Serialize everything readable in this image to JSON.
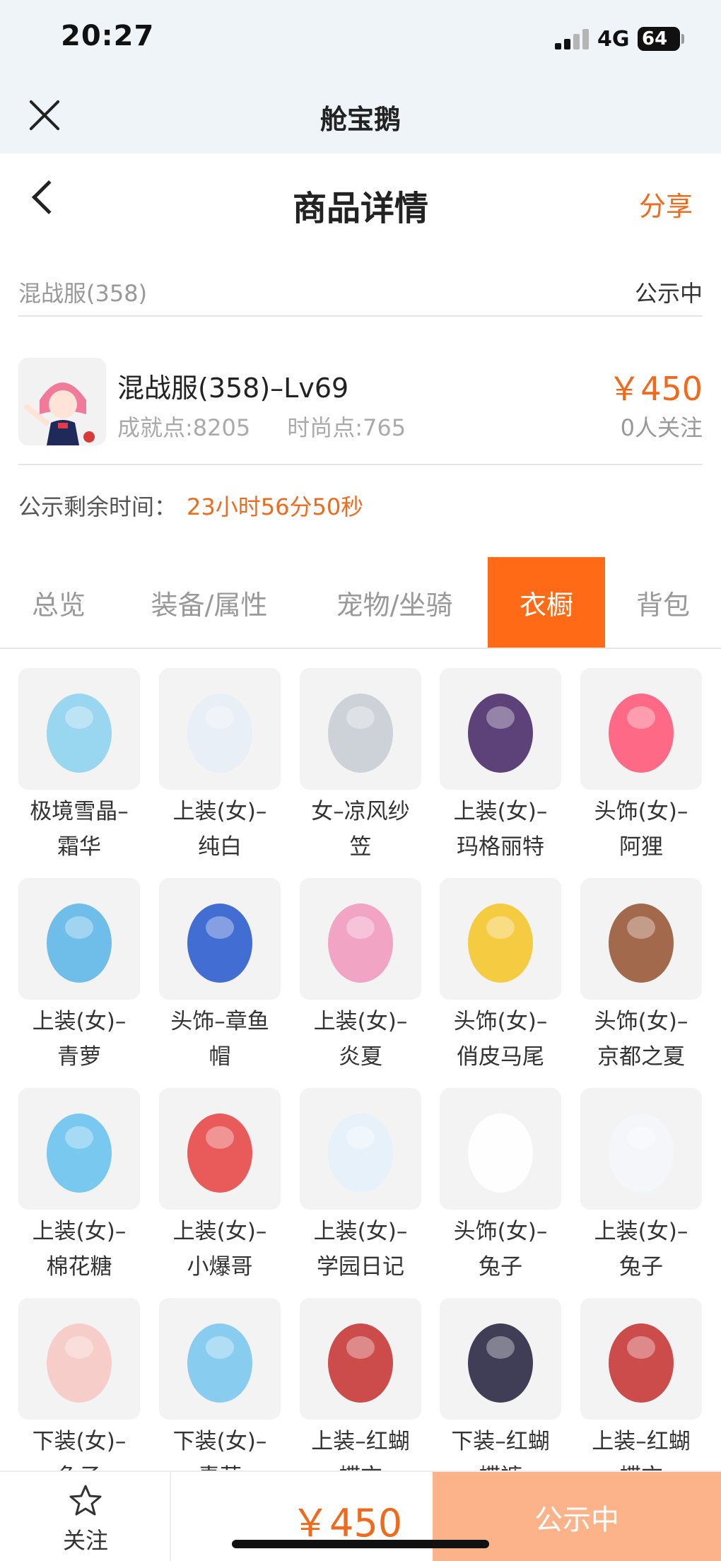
{
  "status_bar": {
    "time": "20:27",
    "network": "4G",
    "battery": "64"
  },
  "mini_header": {
    "title": "舱宝鹅"
  },
  "nav": {
    "title": "商品详情",
    "share": "分享"
  },
  "server": {
    "name": "混战服(358)",
    "status": "公示中"
  },
  "character": {
    "name": "混战服(358)–Lv69",
    "achievement": "成就点:8205",
    "fashion": "时尚点:765",
    "price": "￥450",
    "followers": "0人关注"
  },
  "countdown": {
    "label": "公示剩余时间：",
    "value": "23小时56分50秒"
  },
  "tabs": [
    {
      "label": "总览",
      "active": false
    },
    {
      "label": "装备/属性",
      "active": false
    },
    {
      "label": "宠物/坐骑",
      "active": false
    },
    {
      "label": "衣橱",
      "active": true
    },
    {
      "label": "背包",
      "active": false
    }
  ],
  "wardrobe": [
    {
      "l1": "极境雪晶–",
      "l2": "霜华",
      "icon": "bow-icon",
      "color": "#8fd3ee"
    },
    {
      "l1": "上装(女)–",
      "l2": "纯白",
      "icon": "white-dress-icon",
      "color": "#e8eef6"
    },
    {
      "l1": "女–凉风纱",
      "l2": "笠",
      "icon": "veil-hat-icon",
      "color": "#c9ced6"
    },
    {
      "l1": "上装(女)–",
      "l2": "玛格丽特",
      "icon": "purple-outfit-icon",
      "color": "#4b2f6b"
    },
    {
      "l1": "头饰(女)–",
      "l2": "阿狸",
      "icon": "fox-head-icon",
      "color": "#ff5a7a"
    },
    {
      "l1": "上装(女)–",
      "l2": "青萝",
      "icon": "blue-dress-icon",
      "color": "#5fb8e8"
    },
    {
      "l1": "头饰–章鱼",
      "l2": "帽",
      "icon": "octopus-hat-icon",
      "color": "#2f5fd0"
    },
    {
      "l1": "上装(女)–",
      "l2": "炎夏",
      "icon": "pink-bikini-icon",
      "color": "#f29bc0"
    },
    {
      "l1": "头饰(女)–",
      "l2": "俏皮马尾",
      "icon": "blonde-hair-icon",
      "color": "#f5c62f"
    },
    {
      "l1": "头饰(女)–",
      "l2": "京都之夏",
      "icon": "brown-hair-icon",
      "color": "#9a5a3a"
    },
    {
      "l1": "上装(女)–",
      "l2": "棉花糖",
      "icon": "cloud-dress-icon",
      "color": "#6cc3f0"
    },
    {
      "l1": "上装(女)–",
      "l2": "小爆哥",
      "icon": "red-hoodie-icon",
      "color": "#e84a4a"
    },
    {
      "l1": "上装(女)–",
      "l2": "学园日记",
      "icon": "sailor-uniform-icon",
      "color": "#e6f1fb"
    },
    {
      "l1": "头饰(女)–",
      "l2": "兔子",
      "icon": "bunny-head-icon",
      "color": "#ffffff"
    },
    {
      "l1": "上装(女)–",
      "l2": "兔子",
      "icon": "bunny-suit-icon",
      "color": "#f4f6fb"
    },
    {
      "l1": "下装(女)–",
      "l2": "兔子",
      "icon": "pink-boots-icon",
      "color": "#f7c9c4"
    },
    {
      "l1": "下装(女)–",
      "l2": "青萝",
      "icon": "blue-boots-icon",
      "color": "#7cc8f0"
    },
    {
      "l1": "上装–红蝴",
      "l2": "蝶衣",
      "icon": "red-armor-icon",
      "color": "#c83a3a"
    },
    {
      "l1": "下装–红蝴",
      "l2": "蝶裤",
      "icon": "dark-pants-icon",
      "color": "#2b2a45"
    },
    {
      "l1": "上装–红蝴",
      "l2": "蝶衣",
      "icon": "red-armor-icon",
      "color": "#c83a3a"
    }
  ],
  "bottom_bar": {
    "follow": "关注",
    "price": "￥450",
    "status": "公示中"
  }
}
